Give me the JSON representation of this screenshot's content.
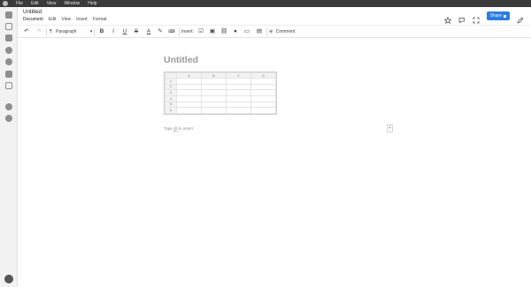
{
  "os_menu": [
    "File",
    "Edit",
    "View",
    "Window",
    "Help"
  ],
  "document": {
    "title": "Untitled",
    "menus": [
      "Document",
      "Edit",
      "View",
      "Insert",
      "Format"
    ],
    "share_label": "Share"
  },
  "toolbar": {
    "paragraph_label": "Paragraph",
    "insert_label": "Insert:",
    "comment_label": "Comment"
  },
  "editor": {
    "page_title": "Untitled",
    "sheet": {
      "columns": [
        "A",
        "B",
        "C",
        "D"
      ],
      "rows": [
        "1",
        "2",
        "3",
        "4",
        "5",
        "6"
      ]
    },
    "placeholder_prefix": "Type",
    "placeholder_key": "@",
    "placeholder_suffix": "to insert",
    "add_block_label": "+"
  },
  "colors": {
    "accent": "#2b7de0",
    "rail_bg": "#f2f2f2",
    "os_bar": "#3a3a3a"
  }
}
